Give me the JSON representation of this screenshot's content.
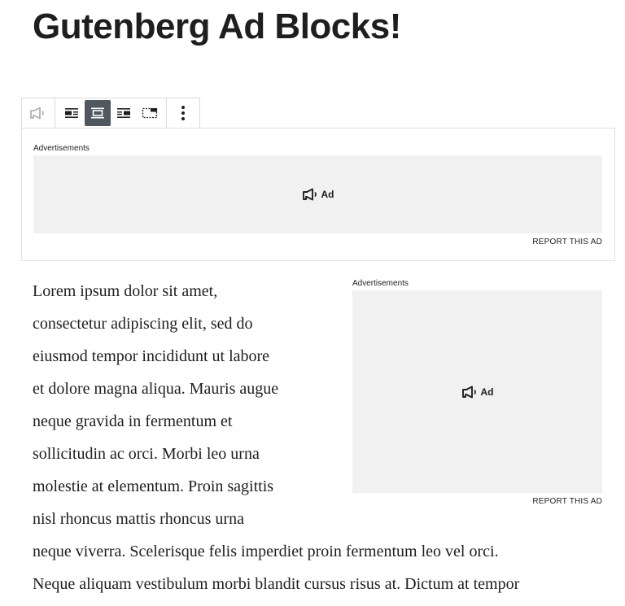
{
  "post": {
    "title": "Gutenberg Ad Blocks!"
  },
  "toolbar": {
    "buttons": [
      {
        "name": "ad-block-type",
        "icon": "megaphone-icon",
        "active": false
      },
      {
        "name": "align-left",
        "icon": "align-left-icon",
        "active": false
      },
      {
        "name": "align-center",
        "icon": "align-center-icon",
        "active": true
      },
      {
        "name": "align-right",
        "icon": "align-right-icon",
        "active": false
      },
      {
        "name": "wide-width",
        "icon": "wide-width-icon",
        "active": false
      },
      {
        "name": "more-options",
        "icon": "more-vertical-icon",
        "active": false
      }
    ]
  },
  "ads": {
    "top": {
      "label": "Advertisements",
      "badge": "Ad",
      "report": "REPORT THIS AD"
    },
    "inline": {
      "label": "Advertisements",
      "badge": "Ad",
      "report": "REPORT THIS AD"
    }
  },
  "content": {
    "lines": [
      "Lorem ipsum dolor sit amet,",
      "consectetur adipiscing elit, sed do",
      "eiusmod tempor incididunt ut labore",
      "et dolore magna aliqua. Mauris augue",
      "neque gravida in fermentum et",
      "sollicitudin ac orci. Morbi leo urna",
      "molestie at elementum. Proin sagittis",
      "nisl rhoncus mattis rhoncus urna",
      "neque viverra. Scelerisque felis imperdiet proin fermentum leo vel orci.",
      "Neque aliquam vestibulum morbi blandit cursus risus at. Dictum at tempor"
    ]
  },
  "colors": {
    "text": "#1e1e1e",
    "toolbar_active": "#50575e",
    "ad_placeholder": "#f1f1f1",
    "border": "#dcdcde"
  }
}
